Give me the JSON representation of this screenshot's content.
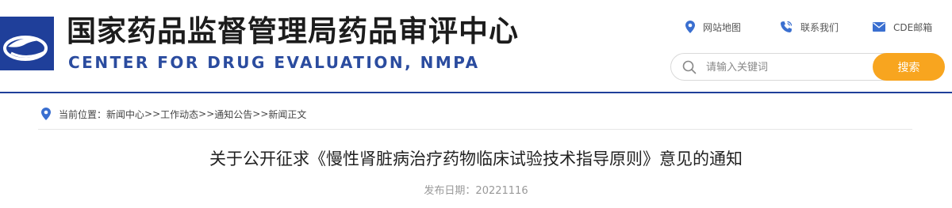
{
  "site": {
    "title_cn": "国家药品监督管理局药品审评中心",
    "title_en": "CENTER FOR DRUG EVALUATION, NMPA"
  },
  "toplinks": {
    "sitemap": "网站地图",
    "contact": "联系我们",
    "mail": "CDE邮箱"
  },
  "search": {
    "placeholder": "请输入关键词",
    "button": "搜索"
  },
  "breadcrumb": {
    "prefix": "当前位置：",
    "items": [
      "新闻中心",
      "工作动态",
      "通知公告",
      "新闻正文"
    ],
    "separator": ">>"
  },
  "article": {
    "title": "关于公开征求《慢性肾脏病治疗药物临床试验技术指导原则》意见的通知",
    "date_label": "发布日期：",
    "date": "20221116"
  },
  "colors": {
    "brand_blue": "#2b4c9f",
    "accent_orange": "#f8a51f",
    "icon_blue": "#3a6fd0"
  }
}
